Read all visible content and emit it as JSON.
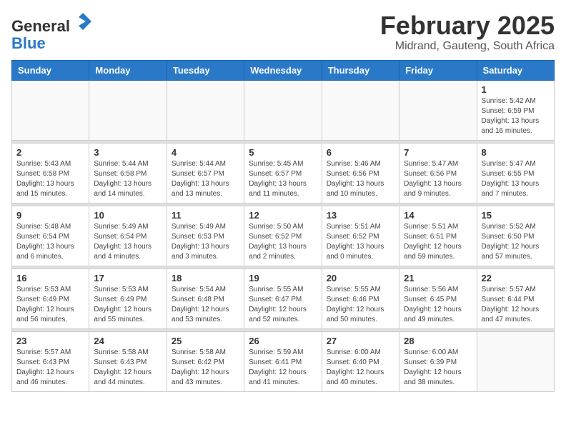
{
  "header": {
    "logo_general": "General",
    "logo_blue": "Blue",
    "month": "February 2025",
    "location": "Midrand, Gauteng, South Africa"
  },
  "weekdays": [
    "Sunday",
    "Monday",
    "Tuesday",
    "Wednesday",
    "Thursday",
    "Friday",
    "Saturday"
  ],
  "weeks": [
    [
      {
        "day": "",
        "info": ""
      },
      {
        "day": "",
        "info": ""
      },
      {
        "day": "",
        "info": ""
      },
      {
        "day": "",
        "info": ""
      },
      {
        "day": "",
        "info": ""
      },
      {
        "day": "",
        "info": ""
      },
      {
        "day": "1",
        "info": "Sunrise: 5:42 AM\nSunset: 6:59 PM\nDaylight: 13 hours\nand 16 minutes."
      }
    ],
    [
      {
        "day": "2",
        "info": "Sunrise: 5:43 AM\nSunset: 6:58 PM\nDaylight: 13 hours\nand 15 minutes."
      },
      {
        "day": "3",
        "info": "Sunrise: 5:44 AM\nSunset: 6:58 PM\nDaylight: 13 hours\nand 14 minutes."
      },
      {
        "day": "4",
        "info": "Sunrise: 5:44 AM\nSunset: 6:57 PM\nDaylight: 13 hours\nand 13 minutes."
      },
      {
        "day": "5",
        "info": "Sunrise: 5:45 AM\nSunset: 6:57 PM\nDaylight: 13 hours\nand 11 minutes."
      },
      {
        "day": "6",
        "info": "Sunrise: 5:46 AM\nSunset: 6:56 PM\nDaylight: 13 hours\nand 10 minutes."
      },
      {
        "day": "7",
        "info": "Sunrise: 5:47 AM\nSunset: 6:56 PM\nDaylight: 13 hours\nand 9 minutes."
      },
      {
        "day": "8",
        "info": "Sunrise: 5:47 AM\nSunset: 6:55 PM\nDaylight: 13 hours\nand 7 minutes."
      }
    ],
    [
      {
        "day": "9",
        "info": "Sunrise: 5:48 AM\nSunset: 6:54 PM\nDaylight: 13 hours\nand 6 minutes."
      },
      {
        "day": "10",
        "info": "Sunrise: 5:49 AM\nSunset: 6:54 PM\nDaylight: 13 hours\nand 4 minutes."
      },
      {
        "day": "11",
        "info": "Sunrise: 5:49 AM\nSunset: 6:53 PM\nDaylight: 13 hours\nand 3 minutes."
      },
      {
        "day": "12",
        "info": "Sunrise: 5:50 AM\nSunset: 6:52 PM\nDaylight: 13 hours\nand 2 minutes."
      },
      {
        "day": "13",
        "info": "Sunrise: 5:51 AM\nSunset: 6:52 PM\nDaylight: 13 hours\nand 0 minutes."
      },
      {
        "day": "14",
        "info": "Sunrise: 5:51 AM\nSunset: 6:51 PM\nDaylight: 12 hours\nand 59 minutes."
      },
      {
        "day": "15",
        "info": "Sunrise: 5:52 AM\nSunset: 6:50 PM\nDaylight: 12 hours\nand 57 minutes."
      }
    ],
    [
      {
        "day": "16",
        "info": "Sunrise: 5:53 AM\nSunset: 6:49 PM\nDaylight: 12 hours\nand 56 minutes."
      },
      {
        "day": "17",
        "info": "Sunrise: 5:53 AM\nSunset: 6:49 PM\nDaylight: 12 hours\nand 55 minutes."
      },
      {
        "day": "18",
        "info": "Sunrise: 5:54 AM\nSunset: 6:48 PM\nDaylight: 12 hours\nand 53 minutes."
      },
      {
        "day": "19",
        "info": "Sunrise: 5:55 AM\nSunset: 6:47 PM\nDaylight: 12 hours\nand 52 minutes."
      },
      {
        "day": "20",
        "info": "Sunrise: 5:55 AM\nSunset: 6:46 PM\nDaylight: 12 hours\nand 50 minutes."
      },
      {
        "day": "21",
        "info": "Sunrise: 5:56 AM\nSunset: 6:45 PM\nDaylight: 12 hours\nand 49 minutes."
      },
      {
        "day": "22",
        "info": "Sunrise: 5:57 AM\nSunset: 6:44 PM\nDaylight: 12 hours\nand 47 minutes."
      }
    ],
    [
      {
        "day": "23",
        "info": "Sunrise: 5:57 AM\nSunset: 6:43 PM\nDaylight: 12 hours\nand 46 minutes."
      },
      {
        "day": "24",
        "info": "Sunrise: 5:58 AM\nSunset: 6:43 PM\nDaylight: 12 hours\nand 44 minutes."
      },
      {
        "day": "25",
        "info": "Sunrise: 5:58 AM\nSunset: 6:42 PM\nDaylight: 12 hours\nand 43 minutes."
      },
      {
        "day": "26",
        "info": "Sunrise: 5:59 AM\nSunset: 6:41 PM\nDaylight: 12 hours\nand 41 minutes."
      },
      {
        "day": "27",
        "info": "Sunrise: 6:00 AM\nSunset: 6:40 PM\nDaylight: 12 hours\nand 40 minutes."
      },
      {
        "day": "28",
        "info": "Sunrise: 6:00 AM\nSunset: 6:39 PM\nDaylight: 12 hours\nand 38 minutes."
      },
      {
        "day": "",
        "info": ""
      }
    ]
  ]
}
